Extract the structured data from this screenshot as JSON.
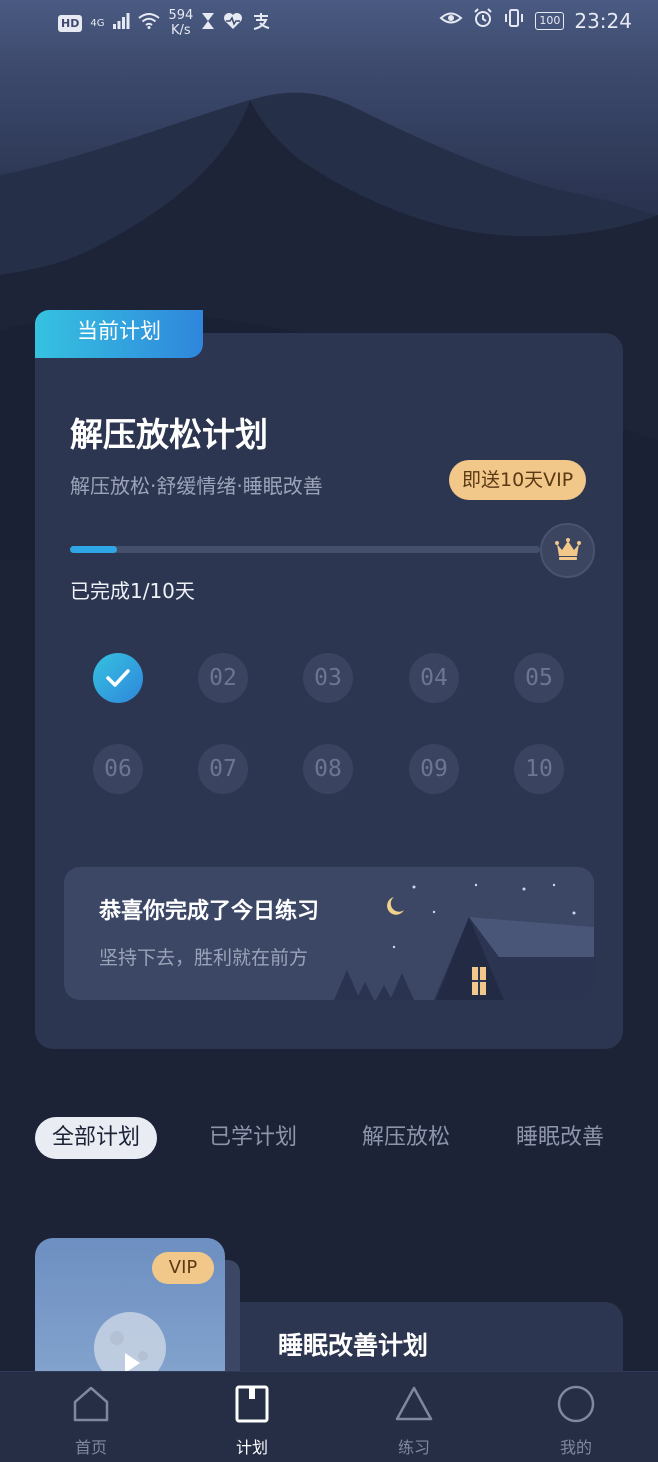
{
  "status_bar": {
    "network": "HD",
    "signal": "4G",
    "speed_value": "594",
    "speed_unit": "K/s",
    "battery": "100",
    "time": "23:24"
  },
  "current_plan": {
    "tag": "当前计划",
    "title": "解压放松计划",
    "subtitle": "解压放松·舒缓情绪·睡眠改善",
    "vip_bonus": "即送10天VIP",
    "progress_fraction": 0.1,
    "progress_text": "已完成1/10天",
    "days": [
      {
        "label": "",
        "done": true
      },
      {
        "label": "02",
        "done": false
      },
      {
        "label": "03",
        "done": false
      },
      {
        "label": "04",
        "done": false
      },
      {
        "label": "05",
        "done": false
      },
      {
        "label": "06",
        "done": false
      },
      {
        "label": "07",
        "done": false
      },
      {
        "label": "08",
        "done": false
      },
      {
        "label": "09",
        "done": false
      },
      {
        "label": "10",
        "done": false
      }
    ],
    "congrats_title": "恭喜你完成了今日练习",
    "congrats_sub": "坚持下去，胜利就在前方"
  },
  "filters": [
    {
      "label": "全部计划",
      "active": true
    },
    {
      "label": "已学计划",
      "active": false
    },
    {
      "label": "解压放松",
      "active": false
    },
    {
      "label": "睡眠改善",
      "active": false
    }
  ],
  "plan_list": [
    {
      "title": "睡眠改善计划",
      "badge": "VIP"
    }
  ],
  "tabbar": [
    {
      "label": "首页",
      "icon": "home-icon",
      "active": false
    },
    {
      "label": "计划",
      "icon": "plan-icon",
      "active": true
    },
    {
      "label": "练习",
      "icon": "practice-icon",
      "active": false
    },
    {
      "label": "我的",
      "icon": "profile-icon",
      "active": false
    }
  ],
  "colors": {
    "accent": "#2fa6e6",
    "vip_gold": "#f2c78a",
    "background": "#1c2336",
    "card": "#2d3650"
  }
}
